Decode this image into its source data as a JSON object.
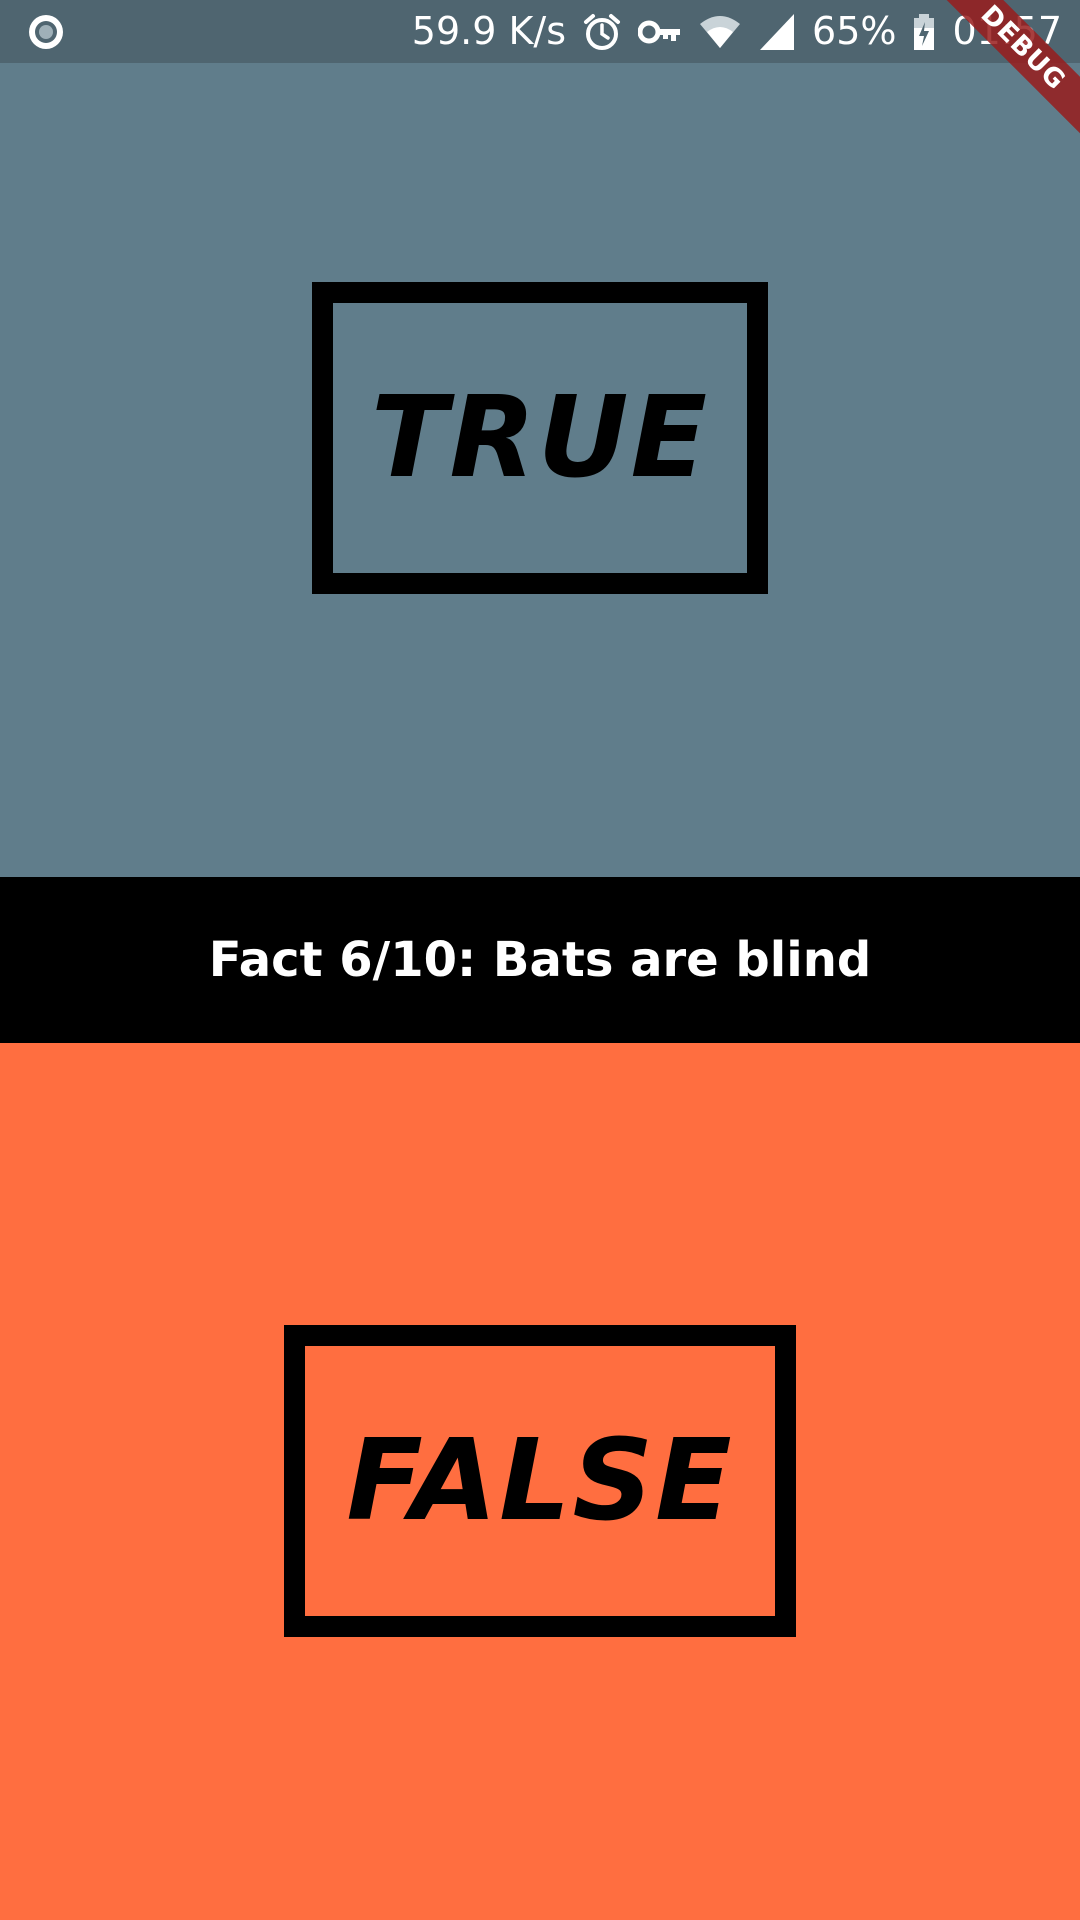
{
  "status_bar": {
    "network_speed": "59.9 K/s",
    "battery_percent": "65%",
    "time": "01:57",
    "icons": [
      "record-icon",
      "alarm-icon",
      "vpn-key-icon",
      "wifi-icon",
      "signal-icon",
      "battery-icon"
    ]
  },
  "debug_banner": {
    "label": "DEBUG"
  },
  "quiz": {
    "true_label": "TRUE",
    "false_label": "FALSE",
    "question": "Fact 6/10: Bats are blind"
  },
  "colors": {
    "status_bar": "#4f6570",
    "true_panel": "#607d8b",
    "question_strip": "#000000",
    "false_panel": "#ff6e40",
    "debug_ribbon": "#981c1c"
  }
}
